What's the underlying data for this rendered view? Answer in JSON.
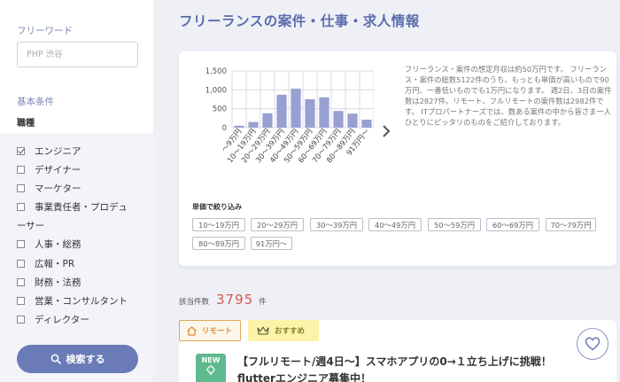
{
  "sidebar": {
    "freeword_label": "フリーワード",
    "search_placeholder": "PHP 渋谷",
    "basic_label": "基本条件",
    "job_type_label": "職種",
    "job_types": [
      {
        "label": "エンジニア",
        "checked": true
      },
      {
        "label": "デザイナー",
        "checked": false
      },
      {
        "label": "マーケター",
        "checked": false
      },
      {
        "label": "事業責任者・プロデュ",
        "checked": false
      },
      {
        "label": "人事・総務",
        "checked": false
      },
      {
        "label": "広報・PR",
        "checked": false
      },
      {
        "label": "財務・法務",
        "checked": false
      },
      {
        "label": "営業・コンサルタント",
        "checked": false
      },
      {
        "label": "ディレクター",
        "checked": false
      }
    ],
    "job_type_continuation": "ーサー",
    "search_button": "検索する"
  },
  "main": {
    "page_title": "フリーランスの案件・仕事・求人情報",
    "description": "フリーランス・案件の想定月収は約50万円です。 フリーランス・案件の総数5122件のうち、もっとも単価が高いもので90万円、一番低いものでも1万円になります。 週2日、3日の案件数は2827件。リモート、フルリモートの案件数は2982件です。 ITプロパートナーズでは、数ある案件の中から皆さま一人ひとりにピッタリのものをご紹介しております。",
    "filter_title": "単価で絞り込み",
    "price_filters": [
      "10〜19万円",
      "20〜29万円",
      "30〜39万円",
      "40〜49万円",
      "50〜59万円",
      "60〜69万円",
      "70〜79万円",
      "80〜89万円",
      "91万円〜"
    ],
    "count_label": "該当件数",
    "count_value": "3795",
    "count_unit": "件"
  },
  "chart_data": {
    "type": "bar",
    "categories": [
      "〜9万円",
      "10〜19万円",
      "20〜29万円",
      "30〜39万円",
      "40〜49万円",
      "50〜59万円",
      "60〜69万円",
      "70〜79万円",
      "80〜89万円",
      "91万円〜"
    ],
    "values": [
      50,
      150,
      380,
      870,
      1030,
      750,
      800,
      440,
      370,
      210
    ],
    "yticks": [
      "0",
      "500",
      "1,000",
      "1,500"
    ],
    "ylim": [
      0,
      1500
    ],
    "grid": true,
    "colors": {
      "bar": "#97a0d1",
      "grid": "#d8dbe3"
    }
  },
  "job": {
    "badge_remote": "リモート",
    "badge_recommended": "おすすめ",
    "new_label": "NEW",
    "title": "【フルリモート/週4日〜】スマホアプリの0→１立ち上げに挑戦！flutterエンジニア募集中！"
  }
}
